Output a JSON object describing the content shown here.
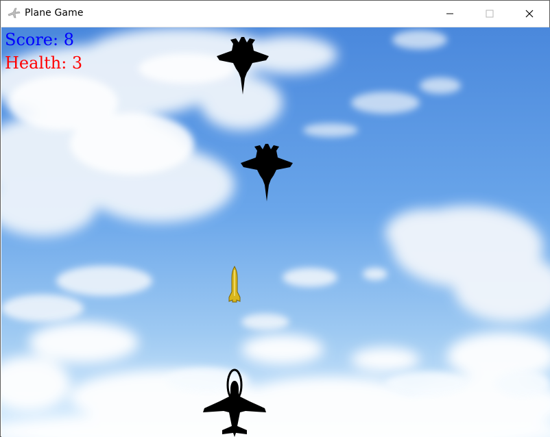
{
  "window": {
    "title": "Plane Game",
    "app_icon": "plane-icon",
    "controls": [
      "minimize-icon",
      "maximize-icon",
      "close-icon"
    ]
  },
  "hud": {
    "score_text": "Score: 8",
    "health_text": "Health: 3",
    "score_color": "#0000ff",
    "health_color": "#ff0000"
  },
  "sprites": {
    "enemy": "enemy-jet-icon",
    "bullet": "missile-icon",
    "player": "player-plane-icon"
  },
  "colors": {
    "sky_top": "#4f8fe0",
    "sky_bottom": "#d9efff",
    "plane": "#000000",
    "missile": "#d9b820"
  }
}
